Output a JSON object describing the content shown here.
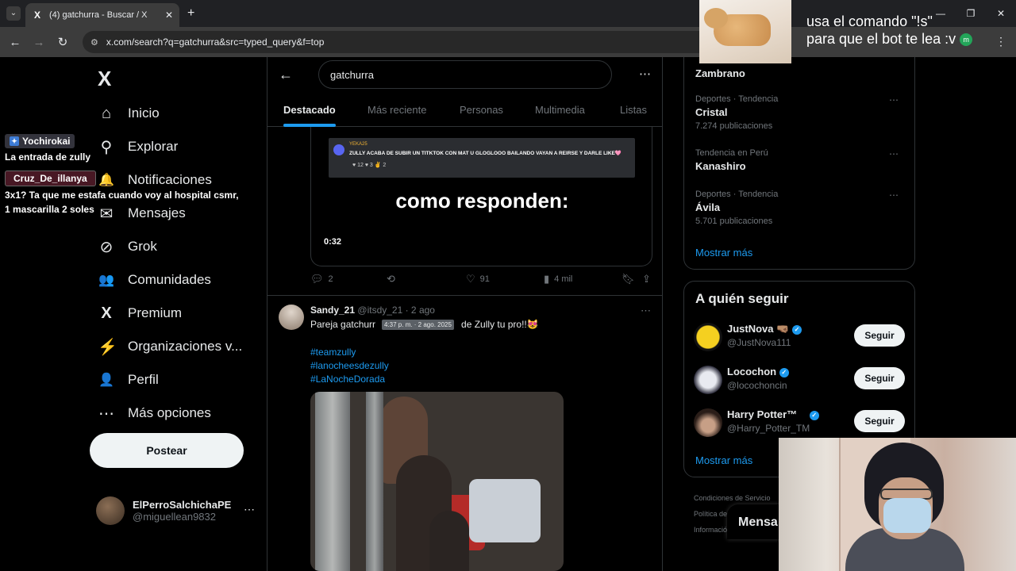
{
  "browser": {
    "tab_title": "(4) gatchurra - Buscar / X",
    "tab_favicon": "X",
    "new_tab": "+",
    "url": "x.com/search?q=gatchurra&src=typed_query&f=top"
  },
  "overlay": {
    "line1": "usa el comando \"!s\"",
    "line2": "para que el bot te lea :v",
    "badge": "m"
  },
  "chat": {
    "user1": "Yochirokai",
    "msg1": "La entrada de zully",
    "user2": "Cruz_De_illanya",
    "msg2": "3x1? Ta que me estafa cuando voy al hospital csmr, 1 mascarilla 2 soles"
  },
  "nav": {
    "logo": "X",
    "items": [
      {
        "label": "Inicio",
        "icon": "⌂"
      },
      {
        "label": "Explorar",
        "icon": "⚲"
      },
      {
        "label": "Notificaciones",
        "icon": "🔔"
      },
      {
        "label": "Mensajes",
        "icon": "✉"
      },
      {
        "label": "Grok",
        "icon": "⊘"
      },
      {
        "label": "Comunidades",
        "icon": "👥"
      },
      {
        "label": "Premium",
        "icon": "X"
      },
      {
        "label": "Organizaciones v...",
        "icon": "⚡"
      },
      {
        "label": "Perfil",
        "icon": "👤"
      },
      {
        "label": "Más opciones",
        "icon": "⋯"
      }
    ],
    "notif_count": "4",
    "post_button": "Postear",
    "profile_name": "ElPerroSalchichaPE",
    "profile_handle": "@miguellean9832"
  },
  "search": {
    "query": "gatchurra",
    "tabs": [
      "Destacado",
      "Más reciente",
      "Personas",
      "Multimedia",
      "Listas"
    ],
    "active_tab": "Destacado"
  },
  "tweet1": {
    "discord_name": "YEKA25",
    "discord_msg": "ZULLY ACABA DE SUBIR UN TITKTOK CON MAT U GLOGLOOO BAILANDO VAYAN A REIRSE Y DARLE LIKE🩷",
    "discord_reacts": "♥ 12   ♥ 3   ✌ 2",
    "caption": "como responden:",
    "duration": "0:32",
    "replies": "2",
    "likes": "91",
    "views": "4 mil"
  },
  "tweet2": {
    "name": "Sandy_21",
    "handle": "@itsdy_21 · 2 ago",
    "text_start": "Pareja gatchurr",
    "text_end": "de Zully tu pro!!😻",
    "tooltip": "4:37 p. m. · 2 ago. 2025",
    "hashtags": [
      "#teamzully",
      "#lanocheesdezully",
      "#LaNocheDorada"
    ]
  },
  "trends": [
    {
      "meta": "",
      "name": "Zambrano",
      "posts": ""
    },
    {
      "meta": "Deportes · Tendencia",
      "name": "Cristal",
      "posts": "7.274 publicaciones"
    },
    {
      "meta": "Tendencia en Perú",
      "name": "Kanashiro",
      "posts": ""
    },
    {
      "meta": "Deportes · Tendencia",
      "name": "Ávila",
      "posts": "5.701 publicaciones"
    }
  ],
  "show_more": "Mostrar más",
  "who_to_follow": {
    "title": "A quién seguir",
    "users": [
      {
        "name": "JustNova 🤜🏽",
        "handle": "@JustNova111"
      },
      {
        "name": "Locochon",
        "handle": "@locochoncin"
      },
      {
        "name": "Harry Potter™",
        "handle": "@Harry_Potter_TM"
      }
    ],
    "follow_label": "Seguir",
    "show_more": "Mostrar más"
  },
  "footer": {
    "terms": "Condiciones de Servicio",
    "privacy": "Política de",
    "info": "Informació"
  },
  "message_drawer": "Mensa"
}
